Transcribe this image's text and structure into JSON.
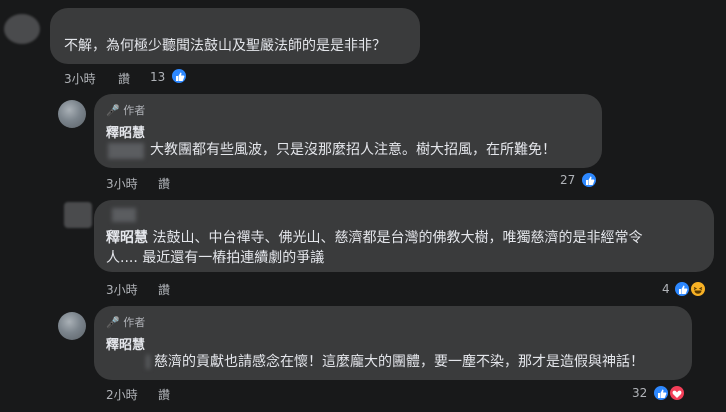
{
  "comments": [
    {
      "text": "不解，為何極少聽聞法鼓山及聖嚴法師的是是非非？",
      "time": "3小時",
      "reply": "讚",
      "reactions": "13"
    },
    {
      "author_tag": "作者",
      "name": "釋昭慧",
      "text": "大教團都有些風波，只是沒那麼招人注意。樹大招風，在所難免！",
      "time": "3小時",
      "reply": "讚",
      "reactions": "27"
    },
    {
      "name": "釋昭慧",
      "text_line1": "法鼓山、中台禪寺、佛光山、慈濟都是台灣的佛教大樹，唯獨慈濟的是非經常令",
      "text_line2": "人.... 最近還有一樁拍連續劇的爭議",
      "time": "3小時",
      "reply": "讚",
      "reactions": "4"
    },
    {
      "author_tag": "作者",
      "name": "釋昭慧",
      "text": "慈濟的貢獻也請感念在懷！這麼龐大的團體，要一塵不染，那才是造假與神話！",
      "time": "2小時",
      "reply": "讚",
      "reactions": "32"
    }
  ],
  "icons": {
    "like": "like-icon",
    "haha": "haha-icon",
    "love": "love-icon",
    "author": "microphone-icon"
  },
  "colors": {
    "background": "#18191a",
    "bubble": "#3a3b3c",
    "text": "#e4e6eb",
    "secondary": "#b0b3b8",
    "like": "#2d88ff"
  }
}
